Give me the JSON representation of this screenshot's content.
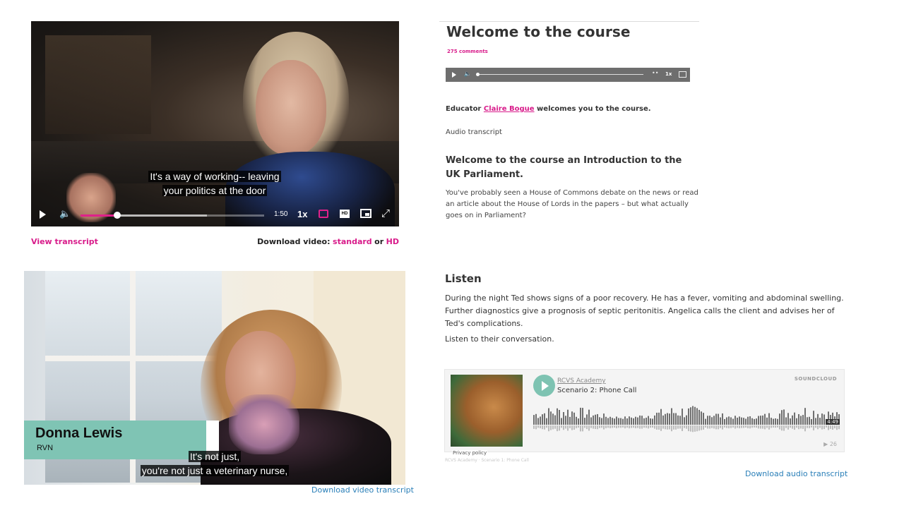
{
  "video1": {
    "caption_line1": "It's a way of working-- leaving",
    "caption_line2": "your politics at the door",
    "time": "1:50",
    "rate": "1x",
    "hd": "HD",
    "progress": 0.2,
    "buffered": 0.69,
    "accent": "#e0218a",
    "icons": [
      "play-icon",
      "volume-icon",
      "captions-icon",
      "hd-icon",
      "picture-in-picture-icon",
      "fullscreen-icon"
    ]
  },
  "video1_links": {
    "view_transcript": "View transcript",
    "download_prefix": "Download video:",
    "standard": "standard",
    "or": "or",
    "hd": "HD"
  },
  "course": {
    "title": "Welcome to the course",
    "comments": "275 comments",
    "audio_rate": "1x",
    "audio_progress": 0.0,
    "educator_prefix": "Educator",
    "educator_name": "Claire Bogue",
    "educator_suffix": "welcomes you to the course.",
    "audio_transcript": "Audio transcript",
    "section_heading": "Welcome to the course an Introduction to the UK Parliament.",
    "intro": "You've probably seen a House of Commons debate on the news or read an article about the House of Lords in the papers – but what actually goes on in Parliament?",
    "link_color": "#d81b8a"
  },
  "video2": {
    "name": "Donna Lewis",
    "role": "RVN",
    "caption_line1": "It's not just,",
    "caption_line2": "you're not just a veterinary nurse,",
    "lower_third_color": "#7fc4b4",
    "download_transcript": "Download video transcript"
  },
  "listen": {
    "heading": "Listen",
    "paragraph": "During the night Ted shows signs of a poor recovery. He has a fever, vomiting and abdominal swelling. Further diagnostics give a prognosis of septic peritonitis. Angelica calls the client and advises her of Ted's complications.",
    "paragraph2": "Listen to their conversation.",
    "soundcloud": {
      "user": "RCVS Academy",
      "track": "Scenario 2: Phone Call",
      "brand": "SOUNDCLOUD",
      "privacy": "Privacy policy",
      "duration": "4:49",
      "plays": "▶ 26",
      "play_color": "#7ec3b2"
    },
    "embed_caption": "RCVS Academy · Scenario 1: Phone Call",
    "download_transcript": "Download audio transcript"
  }
}
